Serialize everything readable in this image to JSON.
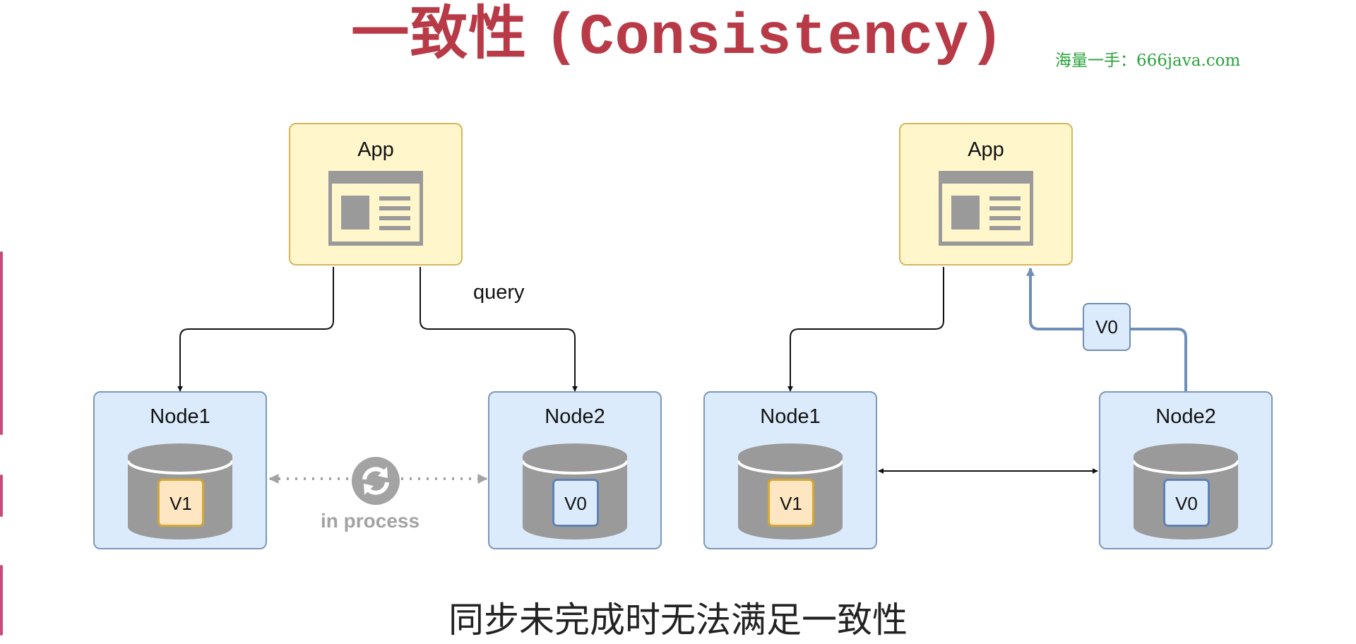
{
  "title": {
    "zh": "一致性",
    "en": "(Consistency)"
  },
  "watermark": "海量一手：666java.com",
  "colors": {
    "title": "#b93a47",
    "watermark": "#2aa23a",
    "app_fill": "#fff6cc",
    "app_border": "#d7b65a",
    "node_fill": "#dcebfb",
    "node_border": "#7d98b8",
    "cylinder": "#9a9a9a",
    "version_new_fill": "#ffe6c2",
    "version_old_fill": "#dcebfb",
    "reply_arrow": "#6f8eb7",
    "sync_gray": "#a3a3a3"
  },
  "left_scenario": {
    "app": {
      "label": "App",
      "icon": "window-icon"
    },
    "query_label": "query",
    "node1": {
      "label": "Node1",
      "version": "V1"
    },
    "node2": {
      "label": "Node2",
      "version": "V0"
    },
    "sync": {
      "icon": "sync-icon",
      "label": "in process"
    }
  },
  "right_scenario": {
    "app": {
      "label": "App",
      "icon": "window-icon"
    },
    "node1": {
      "label": "Node1",
      "version": "V1"
    },
    "node2": {
      "label": "Node2",
      "version": "V0"
    },
    "returned_value": "V0"
  },
  "caption": "同步未完成时无法满足一致性"
}
